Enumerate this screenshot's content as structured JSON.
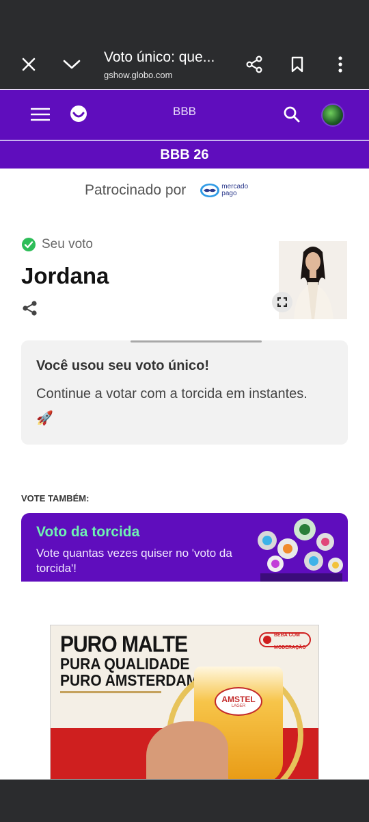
{
  "browser": {
    "title": "Voto único: que...",
    "url": "gshow.globo.com",
    "icons": [
      "close-icon",
      "chevron-down-icon",
      "share-icon",
      "bookmark-icon",
      "more-vert-icon"
    ]
  },
  "site": {
    "brand": "BBB",
    "section": "BBB 26",
    "colors": {
      "primary": "#5f0dbd",
      "accent": "#6ff2b2"
    }
  },
  "sponsor": {
    "label": "Patrocinado por",
    "logo_text_1": "mercado",
    "logo_text_2": "pago"
  },
  "vote": {
    "status_label": "Seu voto",
    "candidate": "Jordana"
  },
  "card": {
    "title": "Você usou seu voto único!",
    "body": "Continue a votar com a torcida em instantes. 🚀"
  },
  "also": {
    "label": "VOTE TAMBÉM:"
  },
  "promo": {
    "title": "Voto da torcida",
    "body": "Vote quantas vezes quiser no 'voto da torcida'!"
  },
  "ad": {
    "line1": "PURO MALTE",
    "line2": "PURA QUALIDADE",
    "line3": "PURO AMSTERDAM",
    "badge_1": "BEBA COM",
    "badge_2": "MODERAÇÃO",
    "brand": "AMSTEL",
    "brand_sub": "LAGER"
  }
}
